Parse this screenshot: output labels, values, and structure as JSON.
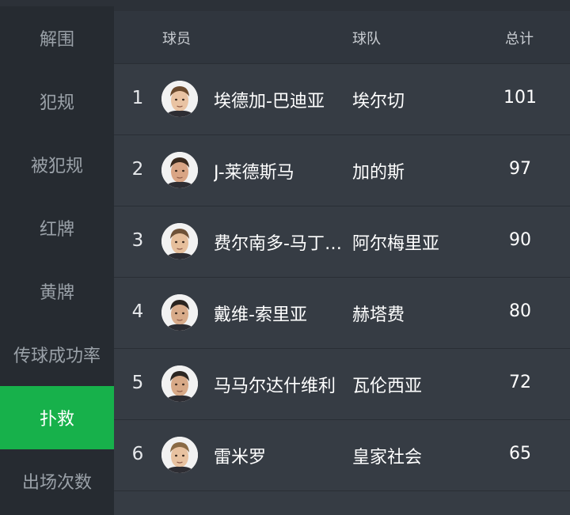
{
  "sidebar": {
    "items": [
      {
        "label": "解围",
        "active": false
      },
      {
        "label": "犯规",
        "active": false
      },
      {
        "label": "被犯规",
        "active": false
      },
      {
        "label": "红牌",
        "active": false
      },
      {
        "label": "黄牌",
        "active": false
      },
      {
        "label": "传球成功率",
        "active": false
      },
      {
        "label": "扑救",
        "active": true
      },
      {
        "label": "出场次数",
        "active": false
      }
    ]
  },
  "table": {
    "headers": {
      "player": "球员",
      "team": "球队",
      "total": "总计"
    },
    "rows": [
      {
        "rank": "1",
        "name": "埃德加-巴迪亚",
        "team": "埃尔切",
        "total": "101",
        "avatar_hair": "#6b4a2e",
        "avatar_skin": "#e9c3a3"
      },
      {
        "rank": "2",
        "name": "J-莱德斯马",
        "team": "加的斯",
        "total": "97",
        "avatar_hair": "#3a2a1e",
        "avatar_skin": "#d9a585"
      },
      {
        "rank": "3",
        "name": "费尔南多-马丁内斯",
        "team": "阿尔梅里亚",
        "total": "90",
        "avatar_hair": "#6e5238",
        "avatar_skin": "#e6bf9c"
      },
      {
        "rank": "4",
        "name": "戴维-索里亚",
        "team": "赫塔费",
        "total": "80",
        "avatar_hair": "#2a2420",
        "avatar_skin": "#d8ab8a"
      },
      {
        "rank": "5",
        "name": "马马尔达什维利",
        "team": "瓦伦西亚",
        "total": "72",
        "avatar_hair": "#2c2622",
        "avatar_skin": "#d7a987"
      },
      {
        "rank": "6",
        "name": "雷米罗",
        "team": "皇家社会",
        "total": "65",
        "avatar_hair": "#8a6a45",
        "avatar_skin": "#e8c2a0"
      }
    ]
  },
  "colors": {
    "accent": "#17b14b",
    "sidebar_bg": "#262b31",
    "row_bg": "#363c44"
  }
}
